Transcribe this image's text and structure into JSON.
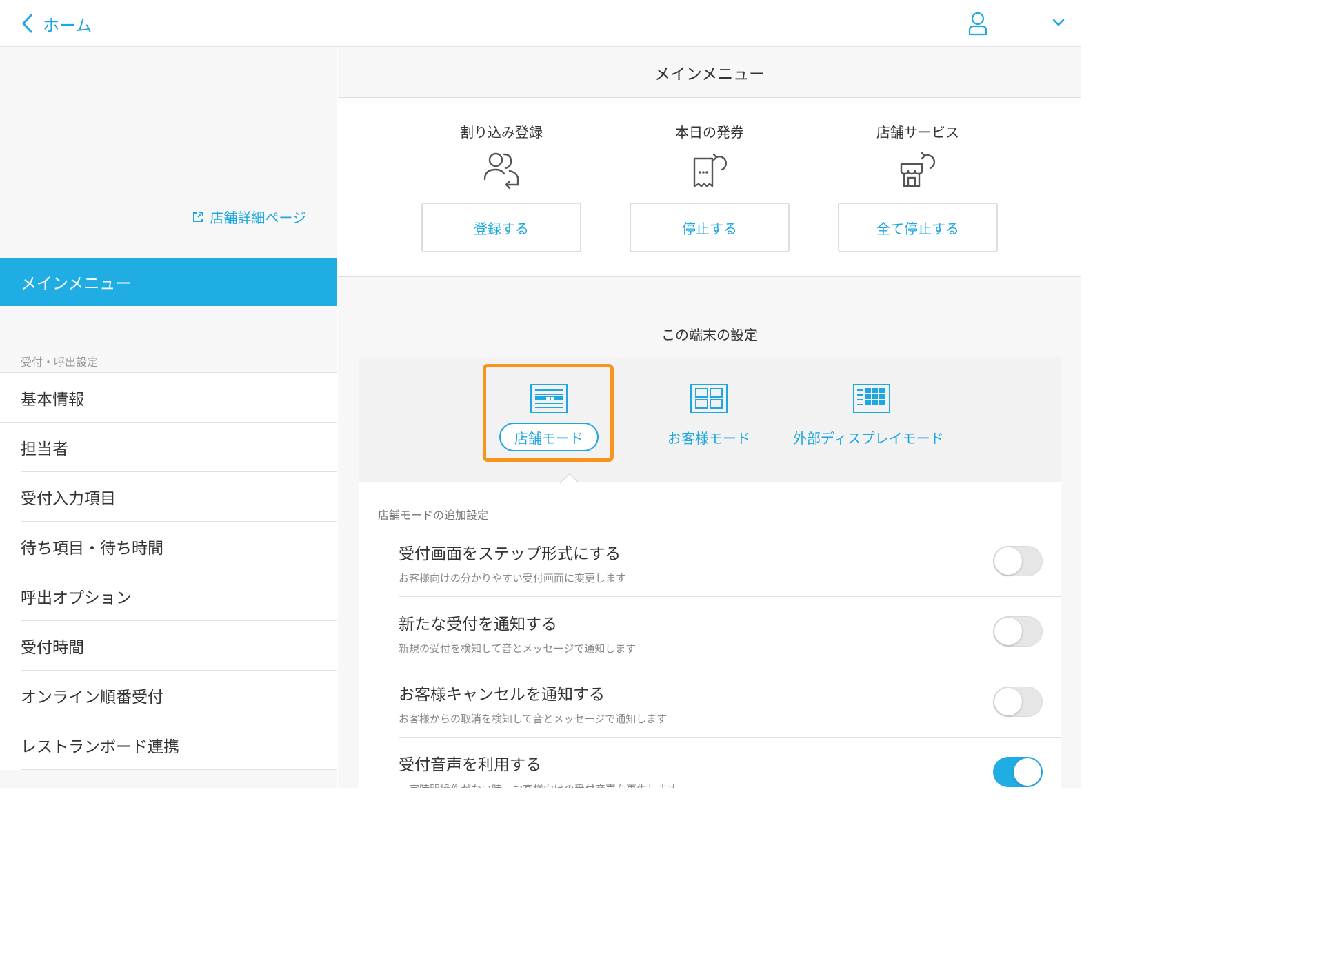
{
  "header": {
    "back_label": "ホーム"
  },
  "sidebar": {
    "store_link": "店舗詳細ページ",
    "active_item": "メインメニュー",
    "section_label": "受付・呼出設定",
    "items": [
      {
        "label": "基本情報"
      },
      {
        "label": "担当者"
      },
      {
        "label": "受付入力項目"
      },
      {
        "label": "待ち項目・待ち時間"
      },
      {
        "label": "呼出オプション"
      },
      {
        "label": "受付時間"
      },
      {
        "label": "オンライン順番受付"
      },
      {
        "label": "レストランボード連携"
      }
    ]
  },
  "main": {
    "title": "メインメニュー",
    "actions": [
      {
        "label": "割り込み登録",
        "button": "登録する",
        "icon": "users-icon"
      },
      {
        "label": "本日の発券",
        "button": "停止する",
        "icon": "ticket-icon"
      },
      {
        "label": "店舗サービス",
        "button": "全て停止する",
        "icon": "shop-icon"
      }
    ],
    "device_settings_title": "この端末の設定",
    "modes": [
      {
        "label": "店舗モード",
        "selected": true,
        "icon": "store-mode-icon"
      },
      {
        "label": "お客様モード",
        "selected": false,
        "icon": "customer-mode-icon"
      },
      {
        "label": "外部ディスプレイモード",
        "selected": false,
        "icon": "external-display-icon"
      }
    ],
    "additional_settings_title": "店舗モードの追加設定",
    "settings": [
      {
        "title": "受付画面をステップ形式にする",
        "description": "お客様向けの分かりやすい受付画面に変更します",
        "enabled": false
      },
      {
        "title": "新たな受付を通知する",
        "description": "新規の受付を検知して音とメッセージで通知します",
        "enabled": false
      },
      {
        "title": "お客様キャンセルを通知する",
        "description": "お客様からの取消を検知して音とメッセージで通知します",
        "enabled": false
      },
      {
        "title": "受付音声を利用する",
        "description": "一定時間操作がない時、お客様向けの受付音声を再生します",
        "enabled": true
      }
    ]
  },
  "colors": {
    "accent": "#1ea7e1",
    "active_bg": "#1fade4",
    "highlight": "#f7941d"
  }
}
